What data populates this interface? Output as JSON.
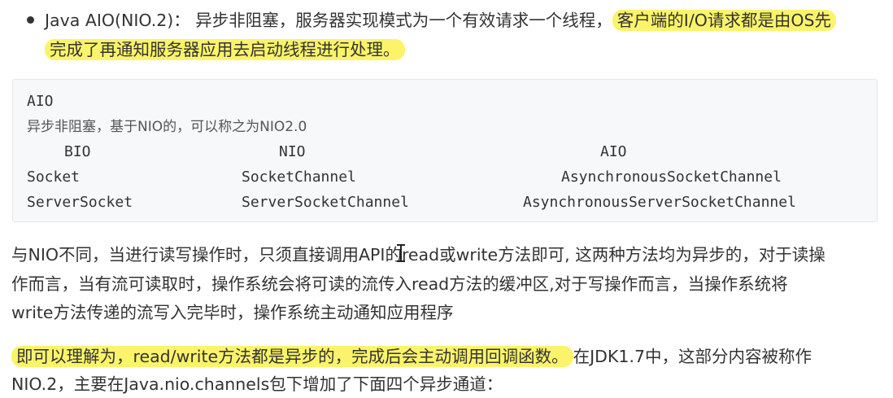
{
  "bullet": {
    "line1_prefix": "Java AIO(NIO.2)：  异步非阻塞，服务器实现模式为一个有效请求一个线程，",
    "line1_highlight": "客户端的I/O请求都是由OS先",
    "line2_highlight": "完成了再通知服务器应用去启动线程进行处理。"
  },
  "code": {
    "title": "AIO",
    "desc": "异步非阻塞，基于NIO的，可以称之为NIO2.0",
    "headers": [
      "BIO",
      "NIO",
      "AIO"
    ],
    "rows": [
      [
        "Socket",
        "SocketChannel",
        "AsynchronousSocketChannel"
      ],
      [
        "ServerSocket",
        "ServerSocketChannel",
        "AsynchronousServerSocketChannel"
      ]
    ]
  },
  "para1": {
    "line1_a": "与NIO不同，当进行读写操作时，只须直接调用API的",
    "line1_b": "read或write方法即可, 这两种方法均为异步的，对于读操",
    "line2": "作而言，当有流可读取时，操作系统会将可读的流传入read方法的缓冲区,对于写操作而言，当操作系统将",
    "line3": "write方法传递的流写入完毕时，操作系统主动通知应用程序"
  },
  "para2": {
    "line1_highlight": "即可以理解为，read/write方法都是异步的，完成后会主动调用回调函数。",
    "line1_rest": "在JDK1.7中，这部分内容被称作",
    "line2": "NIO.2，主要在Java.nio.channels包下增加了下面四个异步通道："
  },
  "colors": {
    "highlight": "#fbf46a",
    "code_bg": "#f6f8fa",
    "text": "#333333"
  }
}
